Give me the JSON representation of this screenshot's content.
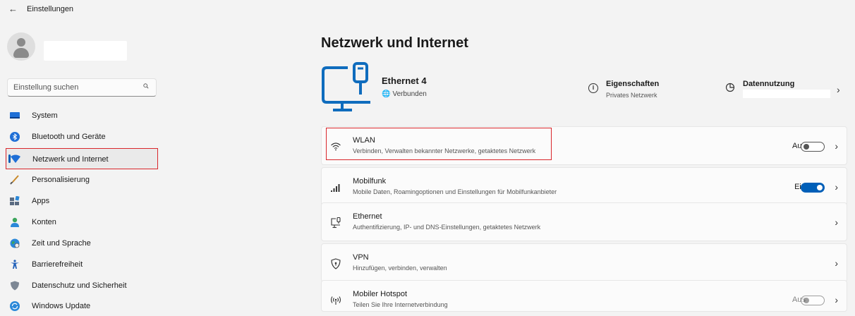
{
  "window": {
    "title": "Einstellungen"
  },
  "sidebar": {
    "search_placeholder": "Einstellung suchen",
    "items": [
      {
        "label": "System",
        "icon": "system-icon"
      },
      {
        "label": "Bluetooth und Geräte",
        "icon": "bluetooth-icon"
      },
      {
        "label": "Netzwerk und Internet",
        "icon": "network-icon",
        "active": true
      },
      {
        "label": "Personalisierung",
        "icon": "brush-icon"
      },
      {
        "label": "Apps",
        "icon": "apps-icon"
      },
      {
        "label": "Konten",
        "icon": "account-icon"
      },
      {
        "label": "Zeit und Sprache",
        "icon": "globe-clock-icon"
      },
      {
        "label": "Barrierefreiheit",
        "icon": "accessibility-icon"
      },
      {
        "label": "Datenschutz und Sicherheit",
        "icon": "shield-icon"
      },
      {
        "label": "Windows Update",
        "icon": "update-icon"
      }
    ]
  },
  "main": {
    "title": "Netzwerk und Internet",
    "connection": {
      "name": "Ethernet 4",
      "status": "Verbunden"
    },
    "properties": {
      "title": "Eigenschaften",
      "subtitle": "Privates Netzwerk"
    },
    "usage": {
      "title": "Datennutzung"
    },
    "cards": [
      {
        "title": "WLAN",
        "subtitle": "Verbinden, Verwalten bekannter Netzwerke, getaktetes Netzwerk",
        "toggle_label": "Aus",
        "toggle_on": false
      },
      {
        "title": "Mobilfunk",
        "subtitle": "Mobile Daten, Roamingoptionen und Einstellungen für Mobilfunkanbieter",
        "toggle_label": "Ein",
        "toggle_on": true
      },
      {
        "title": "Ethernet",
        "subtitle": "Authentifizierung, IP- und DNS-Einstellungen, getaktetes Netzwerk"
      },
      {
        "title": "VPN",
        "subtitle": "Hinzufügen, verbinden, verwalten"
      },
      {
        "title": "Mobiler Hotspot",
        "subtitle": "Teilen Sie Ihre Internetverbindung",
        "toggle_label": "Aus",
        "toggle_on": false,
        "disabled": true
      }
    ]
  },
  "colors": {
    "accent": "#005fb8",
    "highlight": "#d9262b",
    "background": "#f3f3f3",
    "card": "#fbfbfb"
  }
}
